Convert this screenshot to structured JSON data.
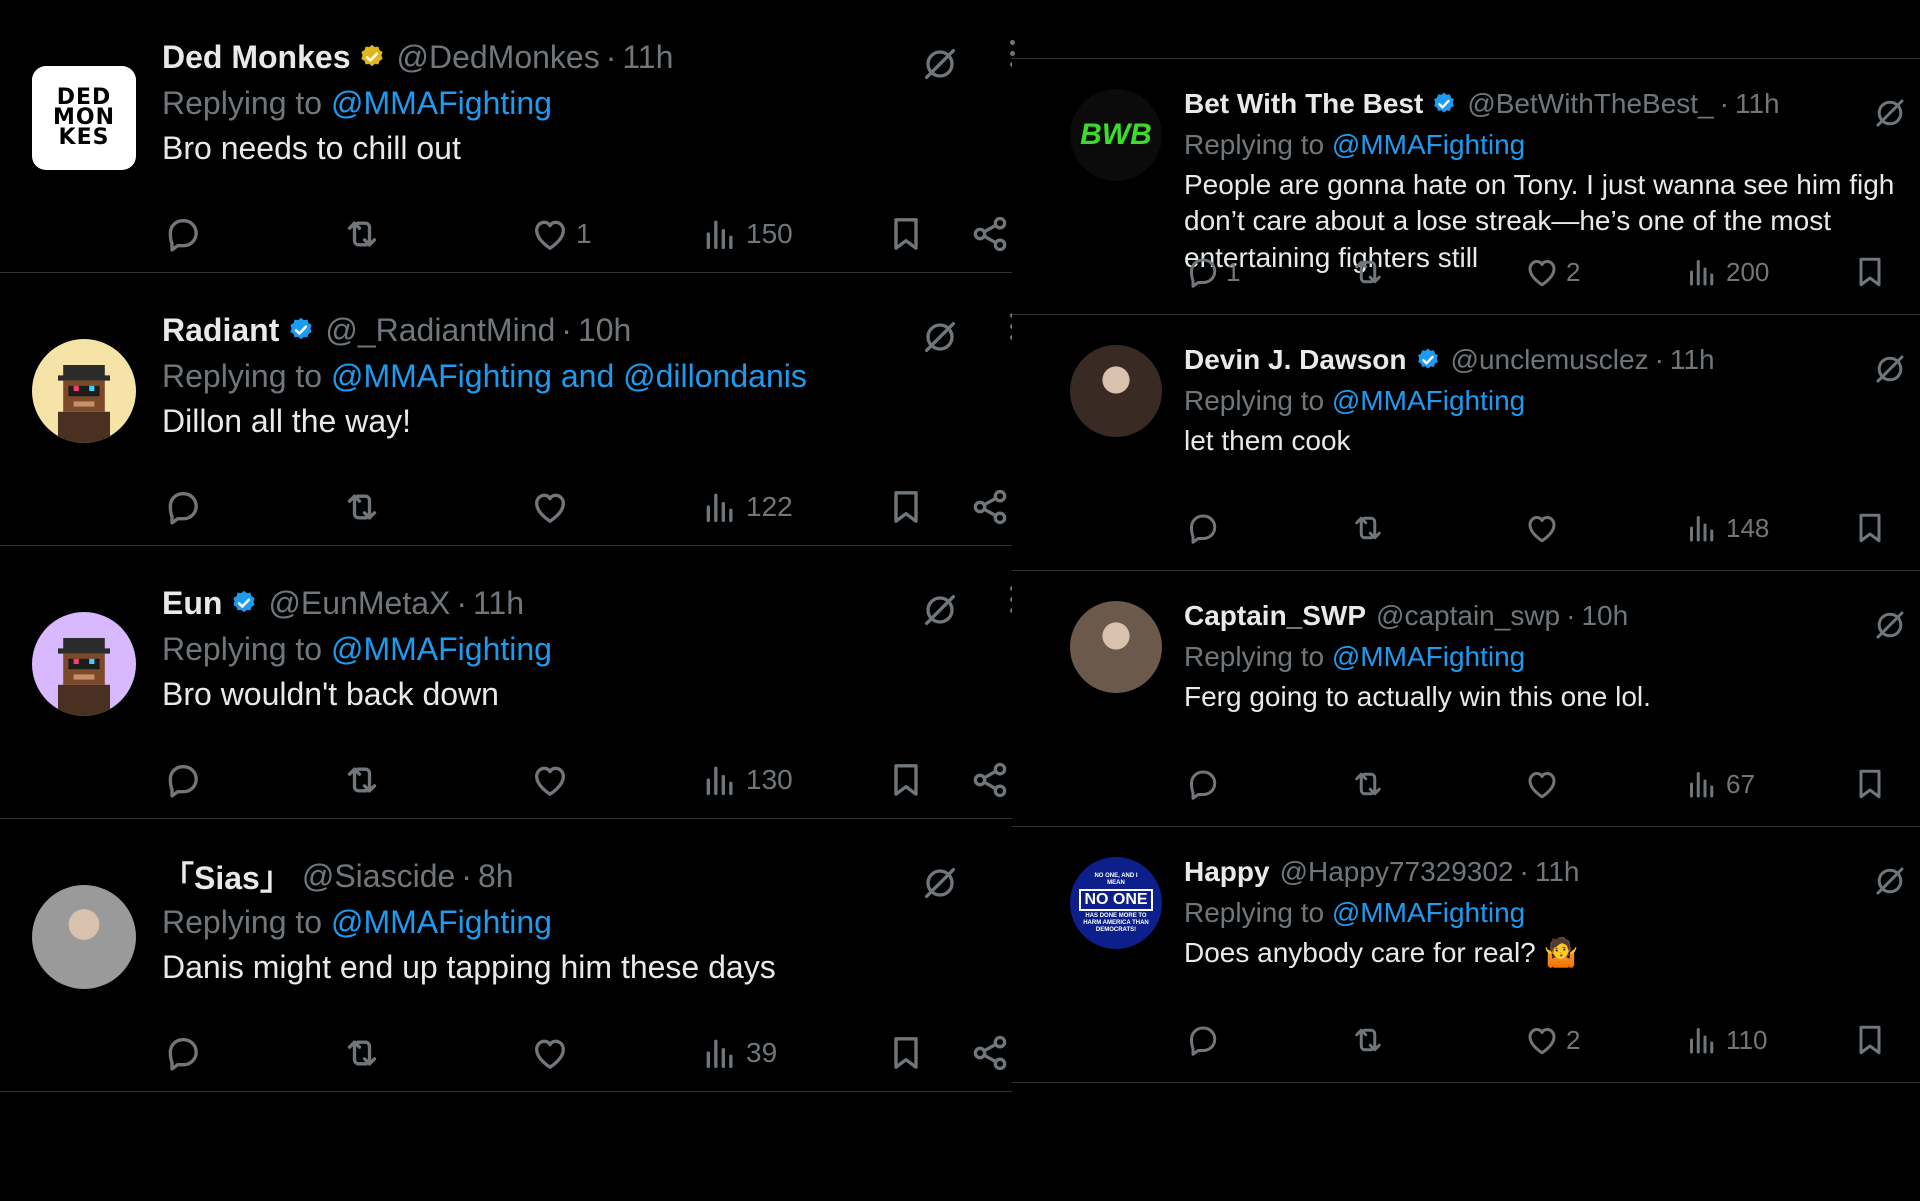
{
  "left_tweets": [
    {
      "name": "Ded Monkes",
      "verified": "gold",
      "handle": "@DedMonkes",
      "time": "11h",
      "reply_prefix": "Replying to ",
      "reply_to": "@MMAFighting",
      "text": "Bro needs to chill out",
      "replies": "",
      "retweets": "",
      "likes": "1",
      "views": "150",
      "avatar": {
        "type": "logo",
        "lines": [
          "DED",
          "MON",
          "KES"
        ]
      },
      "more": true
    },
    {
      "name": "Radiant",
      "verified": "blue",
      "handle": "@_RadiantMind",
      "time": "10h",
      "reply_prefix": "Replying to ",
      "reply_to": "@MMAFighting and @dillondanis",
      "text": "Dillon all the way!",
      "replies": "",
      "retweets": "",
      "likes": "",
      "views": "122",
      "avatar": {
        "type": "pixel",
        "bg": "#f6e3a8"
      },
      "more": true
    },
    {
      "name": "Eun",
      "verified": "blue",
      "handle": "@EunMetaX",
      "time": "11h",
      "reply_prefix": "Replying to ",
      "reply_to": "@MMAFighting",
      "text": "Bro wouldn't back down",
      "replies": "",
      "retweets": "",
      "likes": "",
      "views": "130",
      "avatar": {
        "type": "pixel",
        "bg": "#d8b8ff"
      },
      "more": true
    },
    {
      "name": "「Sias」",
      "verified": "",
      "handle": "@Siascide",
      "time": "8h",
      "reply_prefix": "Replying to ",
      "reply_to": "@MMAFighting",
      "text": "Danis might end up tapping him these days",
      "replies": "",
      "retweets": "",
      "likes": "",
      "views": "39",
      "avatar": {
        "type": "photo",
        "bg": "#9a9a9a"
      },
      "more": false
    }
  ],
  "right_tweets": [
    {
      "name": "Bet With The Best",
      "verified": "blue",
      "handle": "@BetWithTheBest_",
      "time": "11h",
      "reply_prefix": "Replying to ",
      "reply_to": "@MMAFighting",
      "text": "People are gonna hate on Tony. I just wanna see him figh don’t care about a lose streak—he’s one of the most entertaining fighters still",
      "replies": "1",
      "retweets": "",
      "likes": "2",
      "views": "200",
      "avatar": {
        "type": "bwb",
        "label": "BWB"
      }
    },
    {
      "name": "Devin J. Dawson",
      "verified": "blue",
      "handle": "@unclemusclez",
      "time": "11h",
      "reply_prefix": "Replying to ",
      "reply_to": "@MMAFighting",
      "text": "let them cook",
      "replies": "",
      "retweets": "",
      "likes": "",
      "views": "148",
      "avatar": {
        "type": "photo",
        "bg": "#3a2a24"
      }
    },
    {
      "name": "Captain_SWP",
      "verified": "",
      "handle": "@captain_swp",
      "time": "10h",
      "reply_prefix": "Replying to ",
      "reply_to": "@MMAFighting",
      "text": "Ferg going to actually win this one lol.",
      "replies": "",
      "retweets": "",
      "likes": "",
      "views": "67",
      "avatar": {
        "type": "photo",
        "bg": "#6b5a4c"
      }
    },
    {
      "name": "Happy",
      "verified": "",
      "handle": "@Happy77329302",
      "time": "11h",
      "reply_prefix": "Replying to ",
      "reply_to": "@MMAFighting",
      "text": "Does anybody care for real? 🤷",
      "replies": "",
      "retweets": "",
      "likes": "2",
      "views": "110",
      "avatar": {
        "type": "badge",
        "big": "NO ONE",
        "small_top": "NO ONE, AND I MEAN",
        "small_bottom": "HAS DONE MORE TO HARM AMERICA THAN DEMOCRATS!"
      }
    }
  ],
  "colors": {
    "bg": "#000000",
    "text": "#e7e9ea",
    "muted": "#71767b",
    "link": "#1d9bf0",
    "gold": "#e2b719",
    "blue": "#1d9bf0",
    "divider": "#2f3336"
  },
  "icons": [
    "reply-icon",
    "retweet-icon",
    "like-icon",
    "views-icon",
    "bookmark-icon",
    "share-icon",
    "grok-icon",
    "more-icon",
    "verified-badge-icon"
  ]
}
